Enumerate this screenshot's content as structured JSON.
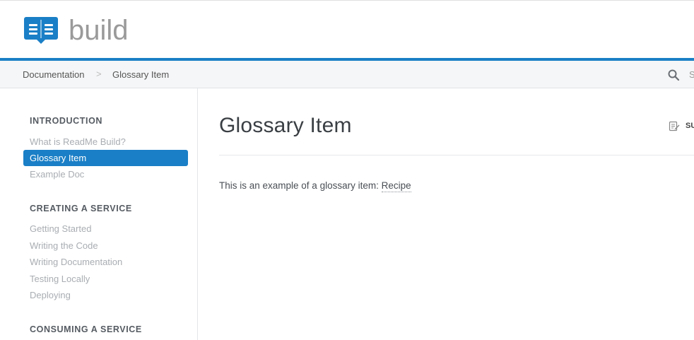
{
  "header": {
    "logo_text": "build",
    "logo_icon": "book-icon",
    "accent_color": "#1a7fc6"
  },
  "breadcrumb": {
    "items": [
      "Documentation",
      "Glossary Item"
    ],
    "separator": ">"
  },
  "search": {
    "icon": "search-icon",
    "label": "S"
  },
  "sidebar": {
    "sections": [
      {
        "title": "INTRODUCTION",
        "items": [
          "What is ReadMe Build?",
          "Glossary Item",
          "Example Doc"
        ]
      },
      {
        "title": "CREATING A SERVICE",
        "items": [
          "Getting Started",
          "Writing the Code",
          "Writing Documentation",
          "Testing Locally",
          "Deploying"
        ]
      },
      {
        "title": "CONSUMING A SERVICE",
        "items": []
      }
    ],
    "active_item": "Glossary Item"
  },
  "main": {
    "title": "Glossary Item",
    "suggest_label": "SU",
    "suggest_icon": "edit-icon",
    "body_prefix": "This is an example of a glossary item: ",
    "glossary_term": "Recipe"
  }
}
